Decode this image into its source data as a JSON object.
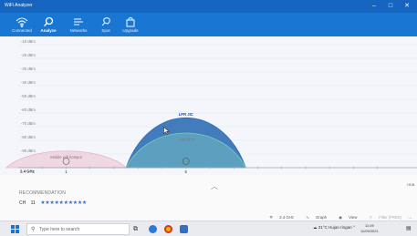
{
  "window": {
    "title": "WiFi Analyzer",
    "minimize": "–",
    "maximize": "□",
    "close": "✕"
  },
  "nav": {
    "items": [
      {
        "label": "Connected",
        "icon": "wifi-icon"
      },
      {
        "label": "Analyze",
        "icon": "magnifier-icon",
        "active": true
      },
      {
        "label": "Networks",
        "icon": "list-icon"
      },
      {
        "label": "Spot",
        "icon": "location-icon"
      },
      {
        "label": "Upgrade",
        "icon": "bag-icon"
      }
    ]
  },
  "chart_data": {
    "type": "area",
    "band": "2.4 GHz",
    "y_ticks": [
      "-10 dBm",
      "-20 dBm",
      "-30 dBm",
      "-40 dBm",
      "-50 dBm",
      "-60 dBm",
      "-70 dBm",
      "-80 dBm",
      "-90 dBm"
    ],
    "ylim": [
      -100,
      -10
    ],
    "x_ticks": [
      "1",
      "6"
    ],
    "xlim": [
      -1,
      15
    ],
    "series": [
      {
        "name": "Mobile wifi hotspot",
        "channel": 1,
        "peak_dbm": -88,
        "color": "#e8b4c4"
      },
      {
        "name": "LPR JIC",
        "channel": 6,
        "peak_dbm": -64,
        "color": "#2f6fb5"
      },
      {
        "name": "Ana 2019",
        "channel": 6,
        "peak_dbm": -75,
        "color": "#7fc9c0"
      }
    ],
    "grid": true
  },
  "lower": {
    "recommendation_label": "RECOMMENDATION",
    "channel_prefix": "CH",
    "channel_value": "11",
    "stars": "★★★★★★★★★★",
    "right_label": "HDB"
  },
  "bottombar": {
    "band": "2.4 GHz",
    "graph": "Graph",
    "view": "View",
    "filter": "Filter (FREE)",
    "more": "..."
  },
  "taskbar": {
    "search_placeholder": "Type here to search",
    "weather": "31°C  Hujan ringan",
    "time": "11:09",
    "date": "11/09/2021"
  }
}
